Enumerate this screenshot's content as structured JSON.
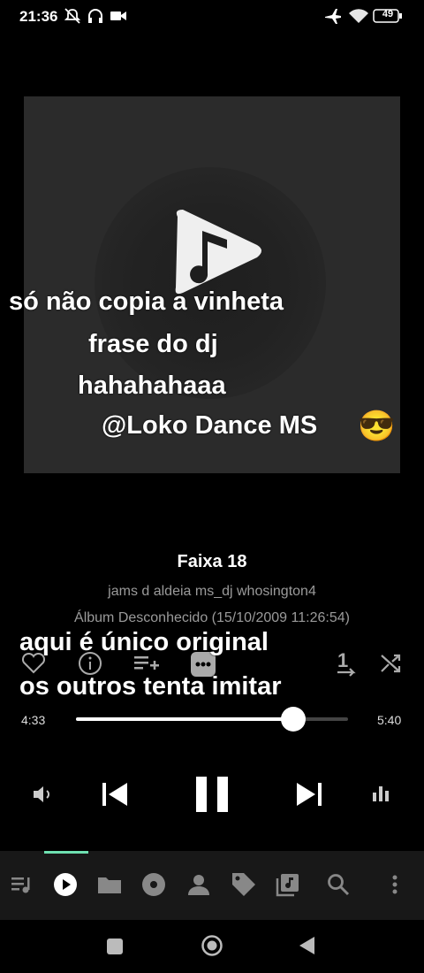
{
  "status_bar": {
    "time": "21:36",
    "battery": "49"
  },
  "album_art": {
    "overlay_lines": [
      "só não copia a vinheta",
      "frase do dj",
      "hahahahaaa",
      "@Loko Dance MS"
    ],
    "emoji": "😎"
  },
  "track": {
    "title": "Faixa 18",
    "artist": "jams d aldeia ms_dj whosington4",
    "album": "Álbum Desconhecido (15/10/2009 11:26:54)"
  },
  "caption": [
    "aqui é único original",
    "os outros tenta imitar"
  ],
  "actions": [
    "favorite",
    "info",
    "add-to-queue",
    "more",
    "repeat-one",
    "shuffle"
  ],
  "repeat_badge": "1",
  "progress": {
    "elapsed": "4:33",
    "total": "5:40",
    "fraction": 0.8
  },
  "controls": [
    "volume",
    "previous",
    "pause",
    "next",
    "equalizer"
  ],
  "bottom_nav": [
    "queue",
    "now-playing",
    "folders",
    "albums",
    "artists",
    "tags",
    "playlists",
    "search",
    "menu"
  ],
  "colors": {
    "accent": "#6ee0b0",
    "background": "#000000",
    "nav_background": "#181818"
  }
}
